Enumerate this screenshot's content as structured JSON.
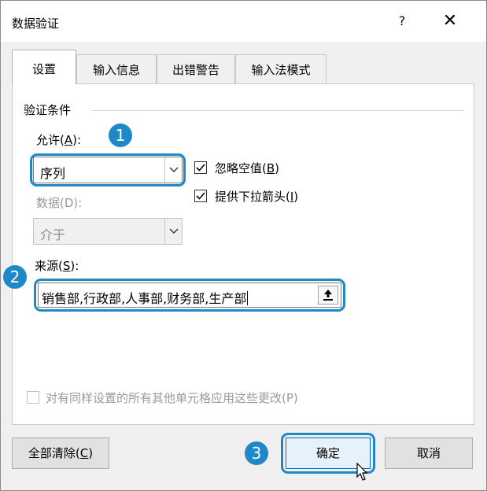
{
  "window": {
    "title": "数据验证",
    "help_label": "?",
    "close_label": "✕"
  },
  "tabs": [
    {
      "label": "设置",
      "active": true
    },
    {
      "label": "输入信息",
      "active": false
    },
    {
      "label": "出错警告",
      "active": false
    },
    {
      "label": "输入法模式",
      "active": false
    }
  ],
  "settings": {
    "group_title": "验证条件",
    "allow": {
      "label_text": "允许(",
      "mnemonic": "A",
      "label_tail": "):",
      "value": "序列"
    },
    "data": {
      "label": "数据(D):",
      "value": "介于"
    },
    "ignore_blank": {
      "label_text": "忽略空值(",
      "mnemonic": "B",
      "label_tail": ")",
      "checked": true
    },
    "dropdown": {
      "label_text": "提供下拉箭头(",
      "mnemonic": "I",
      "label_tail": ")",
      "checked": true
    },
    "source": {
      "label_text": "来源(",
      "mnemonic": "S",
      "label_tail": "):",
      "value": "销售部,行政部,人事部,财务部,生产部"
    },
    "apply_all": {
      "label": "对有同样设置的所有其他单元格应用这些更改(P)",
      "checked": false
    }
  },
  "annotations": {
    "step1": "1",
    "step2": "2",
    "step3": "3"
  },
  "footer": {
    "clear_text": "全部清除(",
    "clear_mnemonic": "C",
    "clear_tail": ")",
    "ok_label": "确定",
    "cancel_label": "取消"
  },
  "colors": {
    "accent": "#1e88c8",
    "primary_border": "#0a64c8"
  }
}
